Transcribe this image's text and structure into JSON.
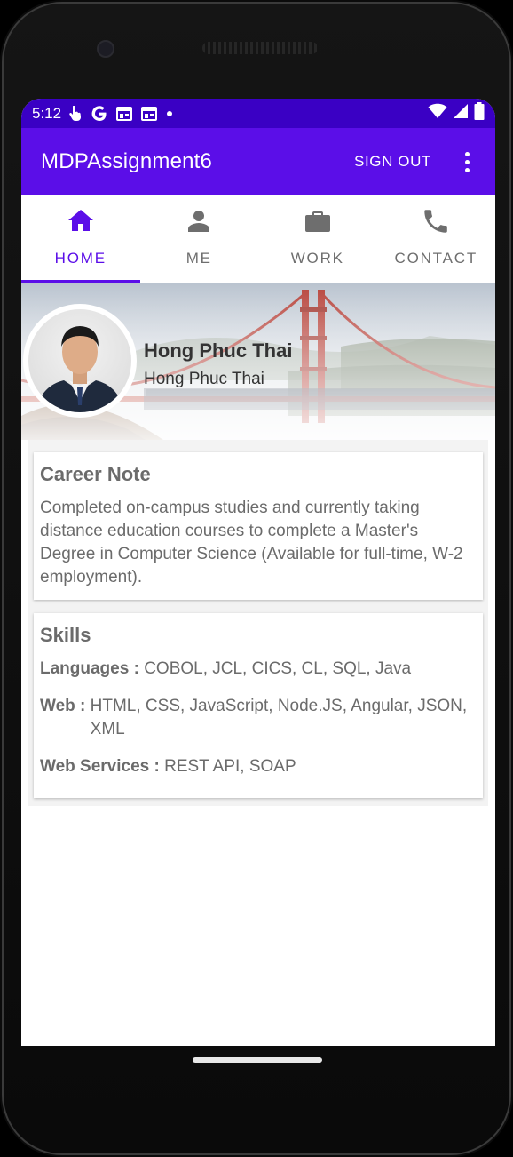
{
  "status_bar": {
    "time": "5:12",
    "icons": [
      "touch-icon",
      "google-icon",
      "calendar-icon",
      "calendar-icon",
      "dot-icon"
    ],
    "right_icons": [
      "wifi-icon",
      "signal-icon",
      "battery-icon"
    ]
  },
  "app_bar": {
    "title": "MDPAssignment6",
    "sign_out_label": "SIGN OUT",
    "more_icon": "more-vert-icon"
  },
  "tabs": [
    {
      "label": "HOME",
      "icon": "home-icon",
      "active": true
    },
    {
      "label": "ME",
      "icon": "person-icon",
      "active": false
    },
    {
      "label": "WORK",
      "icon": "briefcase-icon",
      "active": false
    },
    {
      "label": "CONTACT",
      "icon": "phone-icon",
      "active": false
    }
  ],
  "profile": {
    "name": "Hong Phuc Thai",
    "subtitle": "Hong Phuc Thai"
  },
  "career": {
    "title": "Career Note",
    "text": "Completed on-campus studies and currently taking distance education courses to complete a Master's Degree in Computer Science (Available for full-time, W-2 employment)."
  },
  "skills": {
    "title": "Skills",
    "items": [
      {
        "key": "Languages : ",
        "value": "COBOL, JCL, CICS, CL, SQL, Java"
      },
      {
        "key": "Web : ",
        "value": "HTML, CSS, JavaScript, Node.JS, Angular, JSON, XML"
      },
      {
        "key": "Web Services : ",
        "value": "REST API, SOAP"
      }
    ]
  },
  "colors": {
    "status_bar": "#3a00c4",
    "app_bar": "#5b0ee8",
    "accent": "#5b0ee8",
    "text_gray": "#6b6b6b"
  }
}
